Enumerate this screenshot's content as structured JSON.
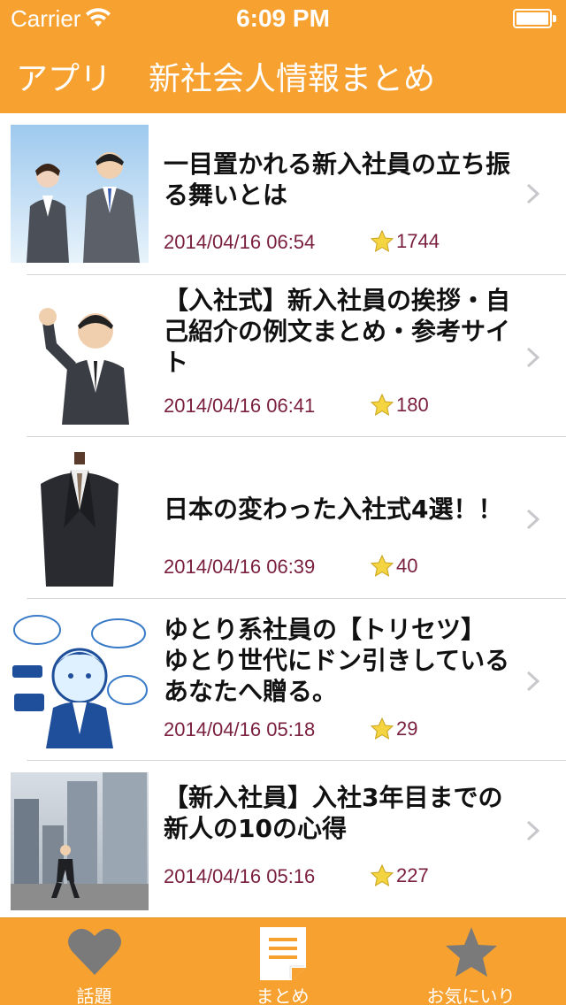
{
  "status_bar": {
    "carrier": "Carrier",
    "time": "6:09 PM"
  },
  "nav": {
    "back_label": "アプリ",
    "title": "新社会人情報まとめ"
  },
  "colors": {
    "accent": "#f7a230",
    "meta_text": "#7a1f3d",
    "star": "#f5d442"
  },
  "articles": [
    {
      "title": "一目置かれる新入社員の立ち振る舞いとは",
      "date": "2014/04/16 06:54",
      "stars": "1744",
      "thumb_icon": "business-people-photo"
    },
    {
      "title": "【入社式】新入社員の挨拶・自己紹介の例文まとめ・参考サイト",
      "date": "2014/04/16 06:41",
      "stars": "180",
      "thumb_icon": "businessman-fist-photo"
    },
    {
      "title": "日本の変わった入社式4選！！",
      "date": "2014/04/16 06:39",
      "stars": "40",
      "thumb_icon": "suit-mannequin-photo"
    },
    {
      "title": "ゆとり系社員の【トリセツ】　ゆとり世代にドン引きしているあなたへ贈る。",
      "date": "2014/04/16 05:18",
      "stars": "29",
      "thumb_icon": "cartoon-employee-illustration"
    },
    {
      "title": "【新入社員】入社3年目までの新人の10の心得",
      "date": "2014/04/16 05:16",
      "stars": "227",
      "thumb_icon": "businessman-running-city-photo"
    }
  ],
  "tabs": [
    {
      "label": "話題",
      "icon": "heart-icon",
      "selected": false
    },
    {
      "label": "まとめ",
      "icon": "document-icon",
      "selected": true
    },
    {
      "label": "お気にいり",
      "icon": "star-icon",
      "selected": false
    }
  ]
}
